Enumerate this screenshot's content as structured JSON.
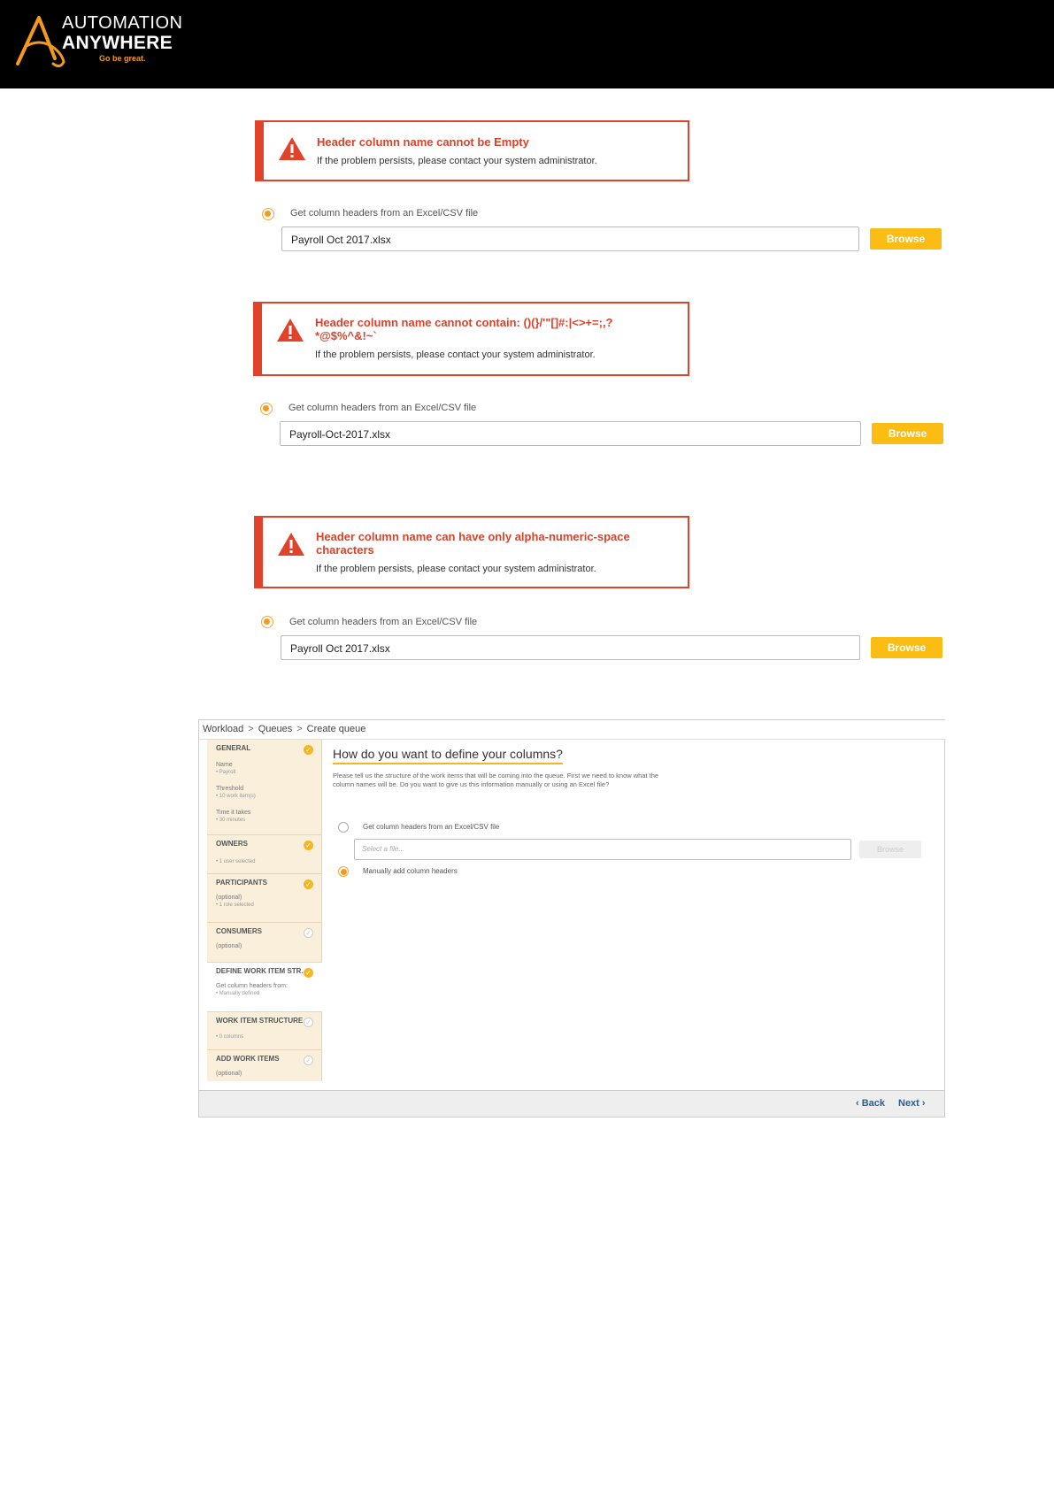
{
  "brand": {
    "line1": "AUTOMATION",
    "line2": "ANYWHERE",
    "tagline": "Go be great.",
    "accent": "#f29a1d"
  },
  "examples": [
    {
      "error_title": "Header column name cannot be Empty",
      "error_sub": "If the problem persists, please contact your system administrator.",
      "radio_label": "Get column headers from an Excel/CSV file",
      "file_value": "Payroll Oct 2017.xlsx",
      "browse_label": "Browse"
    },
    {
      "error_title": "Header column name cannot contain: ()(}/'\"[]#:|<>+=;,? *@$%^&!~`",
      "error_sub": "If the problem persists, please contact your system administrator.",
      "radio_label": "Get column headers from an Excel/CSV file",
      "file_value": "Payroll-Oct-2017.xlsx",
      "browse_label": "Browse"
    },
    {
      "error_title": "Header column name can have only alpha-numeric-space characters",
      "error_sub": "If the problem persists, please contact your system administrator.",
      "radio_label": "Get column headers from an Excel/CSV file",
      "file_value": "Payroll Oct 2017.xlsx",
      "browse_label": "Browse"
    }
  ],
  "create_queue": {
    "breadcrumb": [
      "Workload",
      "Queues",
      "Create queue"
    ],
    "sidebar": [
      {
        "title": "GENERAL",
        "status": "done",
        "lines": [
          [
            "Name",
            "• Payroll"
          ],
          [
            "Threshold",
            "• 10 work item(s)"
          ],
          [
            "Time it takes",
            "• 30 minutes"
          ]
        ]
      },
      {
        "title": "OWNERS",
        "status": "done",
        "lines": [
          [
            "",
            "• 1 user selected"
          ]
        ]
      },
      {
        "title": "PARTICIPANTS",
        "status": "done",
        "lines": [
          [
            "(optional)",
            "• 1 role selected"
          ]
        ]
      },
      {
        "title": "CONSUMERS",
        "status": "pending",
        "lines": [
          [
            "(optional)",
            ""
          ]
        ]
      },
      {
        "title": "DEFINE WORK ITEM STR...",
        "status": "done",
        "lines": [
          [
            "Get column headers from:",
            "• Manually defined"
          ]
        ]
      },
      {
        "title": "WORK ITEM STRUCTURE",
        "status": "pending",
        "lines": [
          [
            "",
            "• 0 columns"
          ]
        ]
      },
      {
        "title": "ADD WORK ITEMS",
        "status": "pending",
        "lines": [
          [
            "(optional)",
            ""
          ]
        ]
      }
    ],
    "heading": "How do you want to define your columns?",
    "description": "Please tell us the structure of the work items that will be coming into the queue. First we need to know what the column names will be. Do you want to give us this information manually or using an Excel file?",
    "option_file": "Get column headers from an Excel/CSV file",
    "file_placeholder": "Select a file...",
    "browse_label": "Browse",
    "option_manual": "Manually add column headers",
    "back_label": "‹ Back",
    "next_label": "Next ›"
  }
}
